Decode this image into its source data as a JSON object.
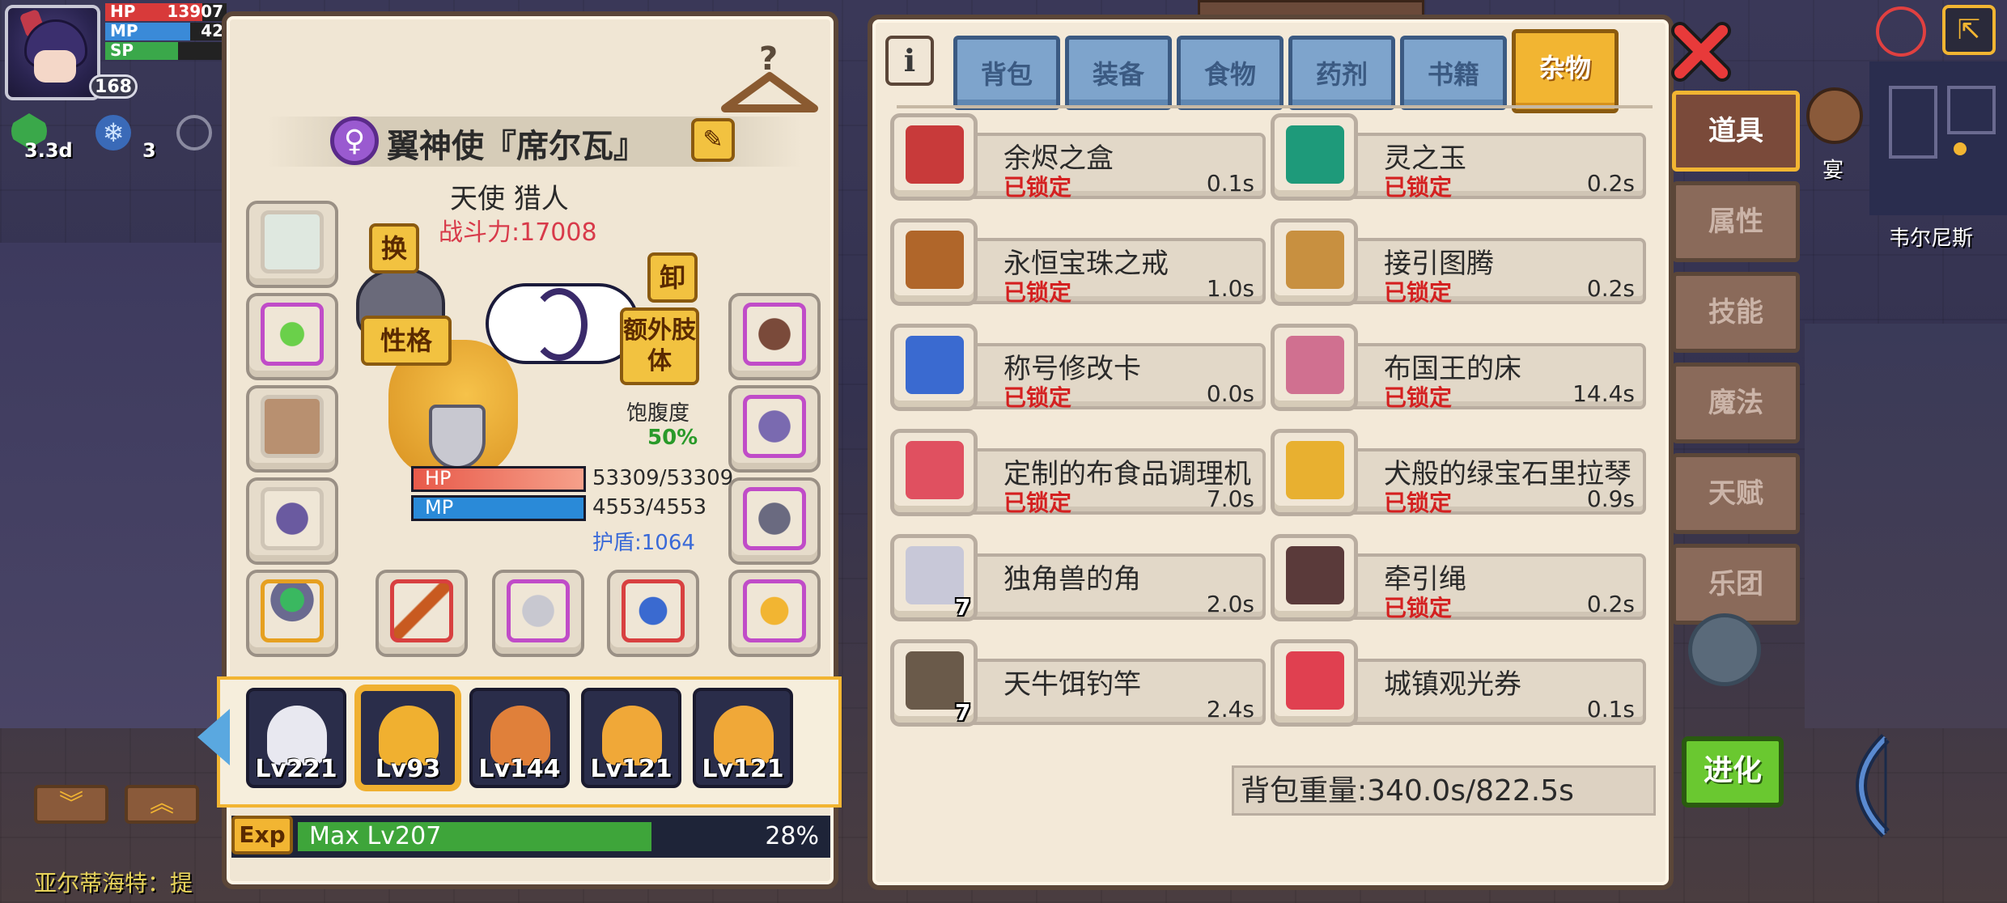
{
  "hud": {
    "hp_label": "HP",
    "hp_value": "13907",
    "mp_label": "MP",
    "mp_value": "42",
    "sp_label": "SP",
    "level": "168",
    "buff_time": "3.3d",
    "buff_count": "3"
  },
  "character": {
    "name": "翼神使『席尔瓦』",
    "class": "天使 猎人",
    "power": "战斗力:17008",
    "btn_swap": "换",
    "btn_personality": "性格",
    "btn_unequip": "卸",
    "btn_extra_limbs": "额外肢体",
    "satiety_label": "饱腹度",
    "satiety_value": "50%",
    "satiety_fraction": 0.5,
    "hp_label": "HP",
    "hp_value": "53309/53309",
    "mp_label": "MP",
    "mp_value": "4553/4553",
    "shield": "护盾:1064"
  },
  "party": [
    {
      "level": "Lv221",
      "hair": "#e8e8f0"
    },
    {
      "level": "Lv93",
      "hair": "#f0b030"
    },
    {
      "level": "Lv144",
      "hair": "#e0803a"
    },
    {
      "level": "Lv121",
      "hair": "#f0a838"
    },
    {
      "level": "Lv121",
      "hair": "#f0a838"
    }
  ],
  "exp": {
    "label": "Exp",
    "level_text": "Max Lv207",
    "percent": "28%",
    "fraction": 0.28
  },
  "tabs": [
    "背包",
    "装备",
    "食物",
    "药剂",
    "书籍",
    "杂物"
  ],
  "active_tab": "杂物",
  "items": [
    {
      "name": "余烬之盒",
      "locked": "已锁定",
      "weight": "0.1s",
      "color": "#c83a3a",
      "count": ""
    },
    {
      "name": "灵之玉",
      "locked": "已锁定",
      "weight": "0.2s",
      "color": "#1e9a7a",
      "count": ""
    },
    {
      "name": "永恒宝珠之戒",
      "locked": "已锁定",
      "weight": "1.0s",
      "color": "#b0662a",
      "count": ""
    },
    {
      "name": "接引图腾",
      "locked": "已锁定",
      "weight": "0.2s",
      "color": "#c89040",
      "count": ""
    },
    {
      "name": "称号修改卡",
      "locked": "已锁定",
      "weight": "0.0s",
      "color": "#3a6ad0",
      "count": ""
    },
    {
      "name": "布国王的床",
      "locked": "已锁定",
      "weight": "14.4s",
      "color": "#d07090",
      "count": ""
    },
    {
      "name": "定制的布食品调理机",
      "locked": "已锁定",
      "weight": "7.0s",
      "color": "#e05060",
      "count": ""
    },
    {
      "name": "犬般的绿宝石里拉琴",
      "locked": "已锁定",
      "weight": "0.9s",
      "color": "#e8b030",
      "count": ""
    },
    {
      "name": "独角兽的角",
      "locked": "",
      "weight": "2.0s",
      "color": "#c8c8d8",
      "count": "7"
    },
    {
      "name": "牵引绳",
      "locked": "已锁定",
      "weight": "0.2s",
      "color": "#5a3a3a",
      "count": ""
    },
    {
      "name": "天牛饵钓竿",
      "locked": "",
      "weight": "2.4s",
      "color": "#6a5a4a",
      "count": "7"
    },
    {
      "name": "城镇观光券",
      "locked": "",
      "weight": "0.1s",
      "color": "#e04050",
      "count": ""
    }
  ],
  "bag_weight": "背包重量:340.0s/822.5s",
  "side_tabs": [
    "道具",
    "属性",
    "技能",
    "魔法",
    "天赋",
    "乐团"
  ],
  "active_side_tab": "道具",
  "evolve_button": "进化",
  "map_location": "韦尔尼斯",
  "map_label_small": "宴",
  "chat_line": "亚尔蒂海特：提",
  "colors": {
    "lock_red": "#d42020",
    "accent_gold": "#f2b532",
    "tab_blue": "#7ea4cc",
    "exp_green": "#3ea53a"
  }
}
